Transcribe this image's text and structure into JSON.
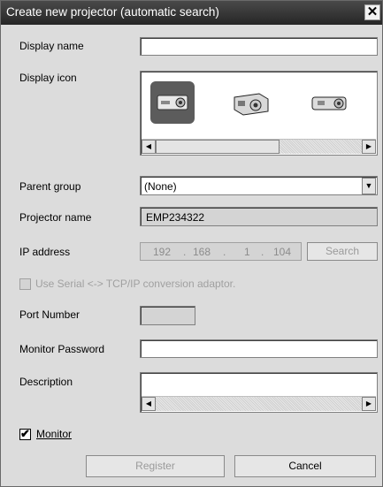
{
  "dialog": {
    "title": "Create new projector (automatic search)",
    "close_glyph": "✕"
  },
  "form": {
    "display_name": {
      "label": "Display name",
      "value": ""
    },
    "display_icon": {
      "label": "Display icon",
      "icons": [
        "projector-icon-1",
        "projector-icon-2",
        "projector-icon-3"
      ]
    },
    "parent_group": {
      "label": "Parent group",
      "value": "(None)"
    },
    "projector_name": {
      "label": "Projector name",
      "value": "EMP234322"
    },
    "ip_address": {
      "label": "IP address",
      "octets": [
        "192",
        "168",
        "1",
        "104"
      ],
      "search_label": "Search"
    },
    "serial_adaptor": {
      "label": "Use Serial <-> TCP/IP conversion adaptor.",
      "checked": false
    },
    "port_number": {
      "label": "Port Number",
      "value": ""
    },
    "monitor_password": {
      "label": "Monitor Password",
      "value": ""
    },
    "description": {
      "label": "Description",
      "value": ""
    },
    "monitor": {
      "label": "Monitor",
      "checked": true
    }
  },
  "buttons": {
    "register": "Register",
    "cancel": "Cancel"
  }
}
